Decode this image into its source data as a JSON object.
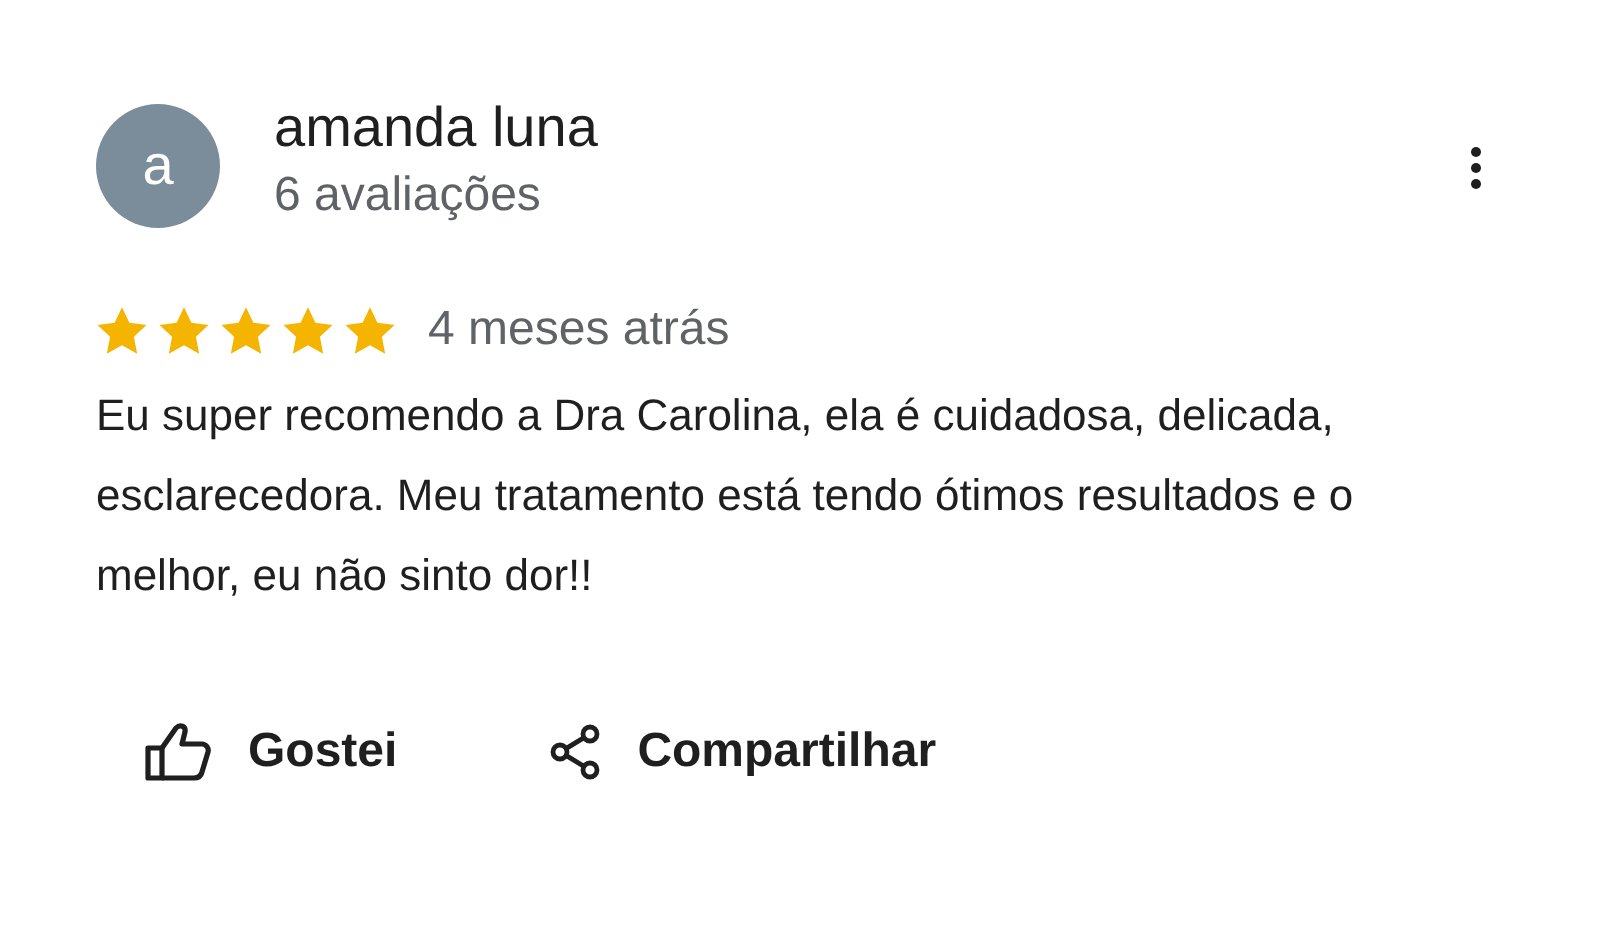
{
  "review": {
    "avatar_letter": "a",
    "author": "amanda luna",
    "author_meta": "6 avaliações",
    "stars": 5,
    "time": "4 meses atrás",
    "text": "Eu super recomendo a Dra Carolina, ela é cuidadosa, delicada, esclarecedora. Meu tratamento está tendo ótimos resultados e o melhor, eu não sinto dor!!"
  },
  "actions": [
    {
      "kind": "like",
      "label": "Gostei"
    },
    {
      "kind": "share",
      "label": "Compartilhar"
    }
  ]
}
